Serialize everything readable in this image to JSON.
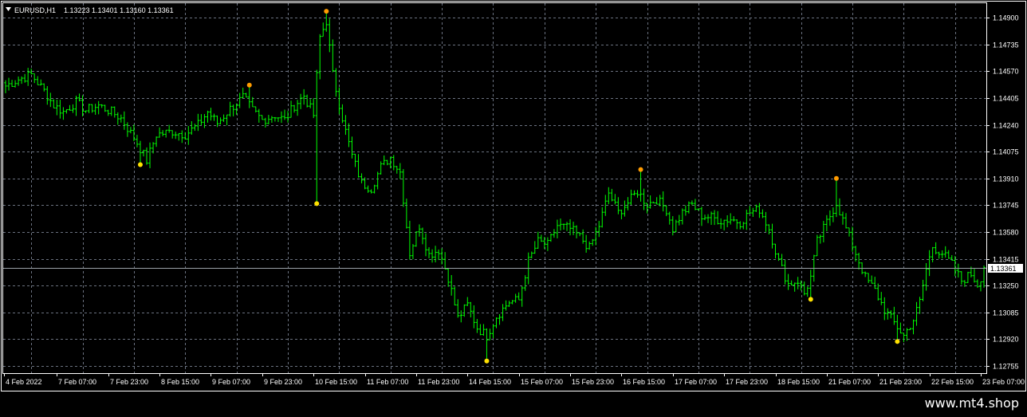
{
  "header": {
    "symbol": "EURUSD,H1",
    "ohlc": "1.13223 1.13401 1.13160 1.13361"
  },
  "watermark": {
    "text": "www.mt4.shop"
  },
  "icons": {
    "dropdown": "triangle-down-icon"
  },
  "colors": {
    "background": "#000000",
    "candle": "#00ff00",
    "grid": "#6b7280",
    "frame": "#ffffff",
    "last_price_line": "#9aa0a6",
    "marker_high": "#ff9b00",
    "marker_low": "#ffe100"
  },
  "chart_data": {
    "type": "line",
    "title": "",
    "xlabel": "",
    "ylabel": "",
    "ylim": [
      1.1271,
      1.1499
    ],
    "grid": true,
    "legend": "none",
    "current_price": 1.13361,
    "current_price_label": "1.13361",
    "y_ticks": [
      1.149,
      1.14735,
      1.1457,
      1.14405,
      1.1424,
      1.14075,
      1.1391,
      1.13745,
      1.1358,
      1.13415,
      1.1325,
      1.13085,
      1.1292,
      1.12755
    ],
    "y_tick_labels": [
      "1.14900",
      "1.14735",
      "1.14570",
      "1.14405",
      "1.14240",
      "1.14075",
      "1.13910",
      "1.13745",
      "1.13580",
      "1.13415",
      "1.13250",
      "1.13085",
      "1.12920",
      "1.12755"
    ],
    "x_tick_labels": [
      "4 Feb 2022",
      "7 Feb 07:00",
      "7 Feb 23:00",
      "8 Feb 15:00",
      "9 Feb 07:00",
      "9 Feb 23:00",
      "10 Feb 15:00",
      "11 Feb 07:00",
      "11 Feb 23:00",
      "14 Feb 15:00",
      "15 Feb 07:00",
      "15 Feb 23:00",
      "16 Feb 15:00",
      "17 Feb 07:00",
      "17 Feb 23:00",
      "18 Feb 15:00",
      "21 Feb 07:00",
      "21 Feb 23:00",
      "22 Feb 15:00",
      "23 Feb 07:00"
    ],
    "x_tick_bars": [
      0,
      16,
      32,
      48,
      64,
      80,
      96,
      112,
      128,
      144,
      160,
      176,
      192,
      208,
      224,
      240,
      256,
      272,
      288,
      304
    ],
    "bars_count": 306,
    "price_path": [
      [
        0,
        1.1448
      ],
      [
        4,
        1.1452
      ],
      [
        8,
        1.1455
      ],
      [
        12,
        1.1445
      ],
      [
        15,
        1.1436
      ],
      [
        18,
        1.1432
      ],
      [
        22,
        1.1438
      ],
      [
        25,
        1.1433
      ],
      [
        29,
        1.1436
      ],
      [
        33,
        1.1432
      ],
      [
        36,
        1.1428
      ],
      [
        41,
        1.1413
      ],
      [
        44,
        1.1402
      ],
      [
        47,
        1.1418
      ],
      [
        52,
        1.142
      ],
      [
        56,
        1.1418
      ],
      [
        60,
        1.1424
      ],
      [
        63,
        1.1432
      ],
      [
        66,
        1.1425
      ],
      [
        70,
        1.1434
      ],
      [
        74,
        1.1441
      ],
      [
        77,
        1.1433
      ],
      [
        80,
        1.1427
      ],
      [
        84,
        1.143
      ],
      [
        87,
        1.1427
      ],
      [
        90,
        1.1436
      ],
      [
        93,
        1.1442
      ],
      [
        96,
        1.143
      ],
      [
        98,
        1.1478
      ],
      [
        100,
        1.1488
      ],
      [
        102,
        1.1455
      ],
      [
        104,
        1.1437
      ],
      [
        106,
        1.142
      ],
      [
        108,
        1.1405
      ],
      [
        111,
        1.1388
      ],
      [
        114,
        1.1385
      ],
      [
        117,
        1.1398
      ],
      [
        120,
        1.1404
      ],
      [
        123,
        1.1395
      ],
      [
        126,
        1.1345
      ],
      [
        129,
        1.1362
      ],
      [
        132,
        1.1344
      ],
      [
        135,
        1.1347
      ],
      [
        138,
        1.133
      ],
      [
        141,
        1.1305
      ],
      [
        144,
        1.1313
      ],
      [
        147,
        1.1299
      ],
      [
        150,
        1.1294
      ],
      [
        153,
        1.1306
      ],
      [
        157,
        1.1315
      ],
      [
        160,
        1.1316
      ],
      [
        163,
        1.134
      ],
      [
        166,
        1.1352
      ],
      [
        169,
        1.135
      ],
      [
        172,
        1.1362
      ],
      [
        176,
        1.136
      ],
      [
        179,
        1.1355
      ],
      [
        182,
        1.1348
      ],
      [
        185,
        1.1362
      ],
      [
        188,
        1.1382
      ],
      [
        191,
        1.137
      ],
      [
        194,
        1.1376
      ],
      [
        197,
        1.1383
      ],
      [
        200,
        1.1375
      ],
      [
        203,
        1.1378
      ],
      [
        206,
        1.1372
      ],
      [
        208,
        1.136
      ],
      [
        211,
        1.137
      ],
      [
        214,
        1.1375
      ],
      [
        217,
        1.1368
      ],
      [
        220,
        1.1367
      ],
      [
        223,
        1.1365
      ],
      [
        226,
        1.1366
      ],
      [
        229,
        1.1364
      ],
      [
        232,
        1.137
      ],
      [
        235,
        1.1372
      ],
      [
        238,
        1.136
      ],
      [
        241,
        1.134
      ],
      [
        244,
        1.1326
      ],
      [
        247,
        1.1328
      ],
      [
        249,
        1.132
      ],
      [
        251,
        1.133
      ],
      [
        253,
        1.1352
      ],
      [
        256,
        1.1364
      ],
      [
        259,
        1.1376
      ],
      [
        262,
        1.136
      ],
      [
        265,
        1.1345
      ],
      [
        268,
        1.133
      ],
      [
        271,
        1.1322
      ],
      [
        274,
        1.131
      ],
      [
        277,
        1.1302
      ],
      [
        280,
        1.1294
      ],
      [
        283,
        1.1304
      ],
      [
        285,
        1.1315
      ],
      [
        287,
        1.1335
      ],
      [
        289,
        1.1349
      ],
      [
        292,
        1.1345
      ],
      [
        295,
        1.1338
      ],
      [
        298,
        1.1328
      ],
      [
        301,
        1.1332
      ],
      [
        303,
        1.1326
      ],
      [
        305,
        1.1334
      ]
    ],
    "markers_high": [
      [
        100,
        1.1494
      ],
      [
        76,
        1.14485
      ],
      [
        198,
        1.13965
      ],
      [
        259,
        1.1391
      ]
    ],
    "markers_low": [
      [
        42,
        1.13995
      ],
      [
        97,
        1.13755
      ],
      [
        150,
        1.12785
      ],
      [
        251,
        1.13165
      ],
      [
        278,
        1.12905
      ]
    ]
  }
}
